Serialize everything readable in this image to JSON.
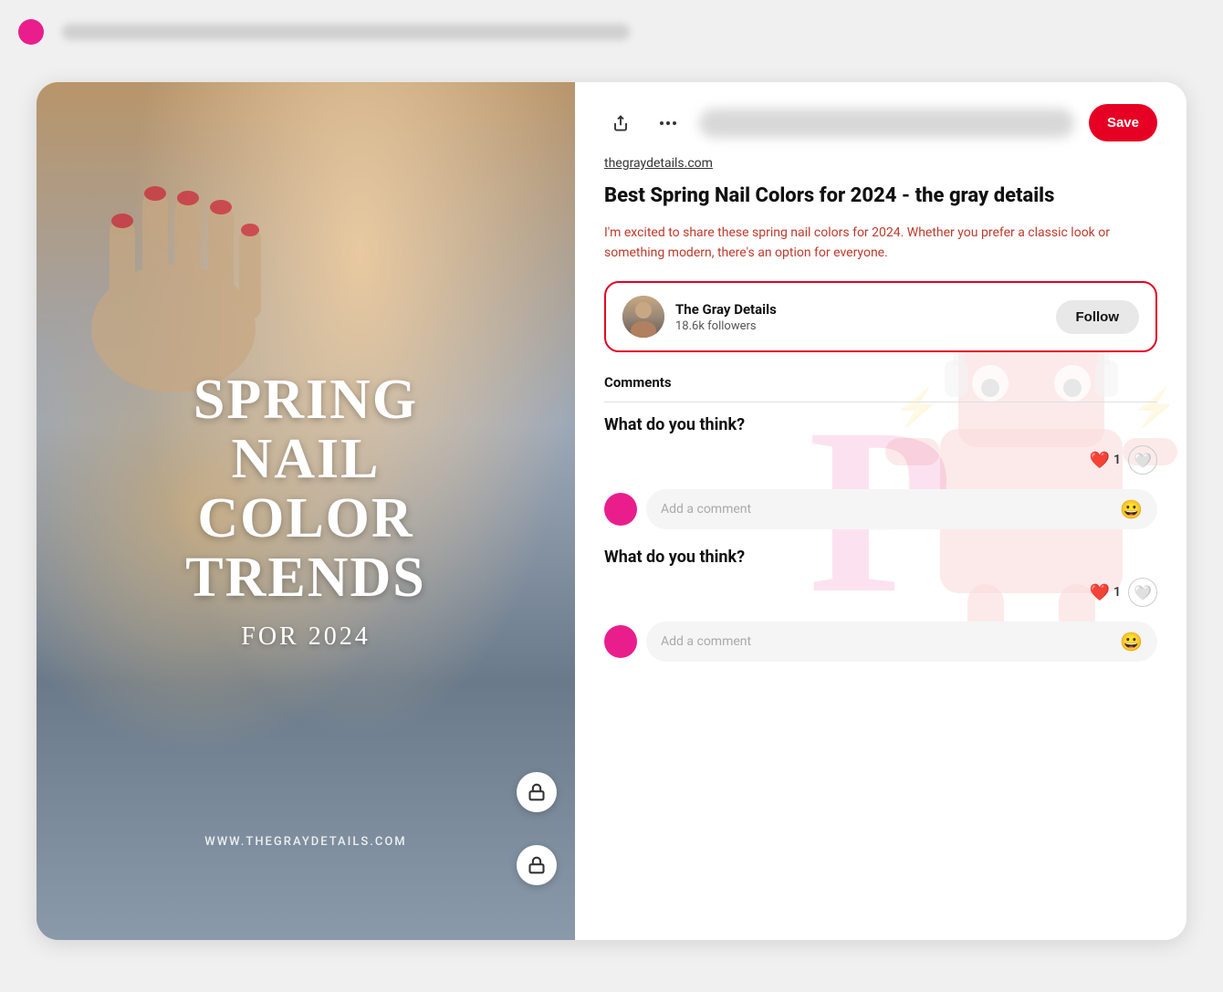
{
  "topbar": {
    "has_dot": true,
    "dot_color": "#e91e8c"
  },
  "header": {
    "save_label": "Save",
    "more_icon": "•••",
    "share_icon": "↑"
  },
  "post": {
    "source_url": "thegraydetails.com",
    "title": "Best Spring Nail Colors for 2024 - the gray details",
    "description": "I'm excited to share these spring nail colors for 2024. Whether you prefer a classic look or something modern, there's an option for everyone."
  },
  "author": {
    "name": "The Gray Details",
    "followers": "18.6k followers",
    "follow_label": "Follow"
  },
  "comments": {
    "section_label": "Comments",
    "prompt_1": "What do you think?",
    "like_count_1": "1",
    "add_comment_placeholder_1": "Add a comment",
    "prompt_2": "What do you think?",
    "like_count_2": "1",
    "add_comment_placeholder_2": "Add a comment"
  },
  "image": {
    "title_line1": "SPRING",
    "title_line2": "NAIL",
    "title_line3": "COLOR",
    "title_line4": "TRENDS",
    "subtitle": "FOR 2024",
    "url_text": "WWW.THEGRAYDETAILS.COM"
  }
}
